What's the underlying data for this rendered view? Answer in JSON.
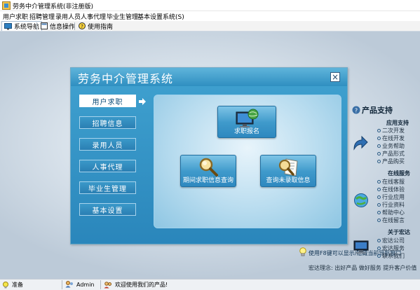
{
  "window": {
    "title": "劳务中介管理系统(非注册版)"
  },
  "menu": [
    "用户求职",
    "招聘管理",
    "录用人员",
    "人事代理",
    "毕业生管理",
    "基本设置",
    "系统(S)"
  ],
  "toolbar": [
    {
      "label": "系统导航",
      "icon": "monitor-icon",
      "active": true
    },
    {
      "label": "信息操作",
      "icon": "document-icon",
      "active": false
    },
    {
      "label": "使用指南",
      "icon": "help-icon",
      "active": false
    }
  ],
  "panel": {
    "title": "劳务中介管理系统",
    "close": "×",
    "nav": [
      {
        "label": "用户求职",
        "active": true
      },
      {
        "label": "招聘信息",
        "active": false
      },
      {
        "label": "录用人员",
        "active": false
      },
      {
        "label": "人事代理",
        "active": false
      },
      {
        "label": "毕业生管理",
        "active": false
      },
      {
        "label": "基本设置",
        "active": false
      }
    ],
    "tiles": [
      {
        "label": "求职报名",
        "icon": "globe-monitor-icon"
      },
      {
        "label": "期间求职信息查询",
        "icon": "magnifier-icon"
      },
      {
        "label": "查询未录取信息",
        "icon": "magnifier-document-icon"
      }
    ],
    "tip": "使用F8键可以显示/隐藏当前导航窗口"
  },
  "support": {
    "title": "产品支持",
    "sections": [
      {
        "title": "应用支持",
        "links": [
          "二次开发",
          "在线开发",
          "业务帮助",
          "产品形式",
          "产品购买"
        ],
        "icon": "arrow-forward-icon"
      },
      {
        "title": "在线服务",
        "links": [
          "在线客服",
          "在线体验",
          "行业应用",
          "行业资料",
          "帮助中心",
          "在线留言"
        ],
        "icon": "globe-refresh-icon"
      },
      {
        "title": "关于宏达",
        "links": [
          "宏达公司",
          "宏达服务",
          "联系我们"
        ],
        "icon": "computer-icon"
      }
    ],
    "motto": "宏达理念: 出好产品 做好服务 提升客户价值"
  },
  "status": {
    "state": "准备",
    "user": "Admin",
    "welcome": "欢迎使用我们的产品!"
  },
  "colors": {
    "panel_header": "#3596c8",
    "panel_body": "#2f8cc0",
    "nav_button": "#3190c4",
    "workspace": "#d7e1ea"
  }
}
